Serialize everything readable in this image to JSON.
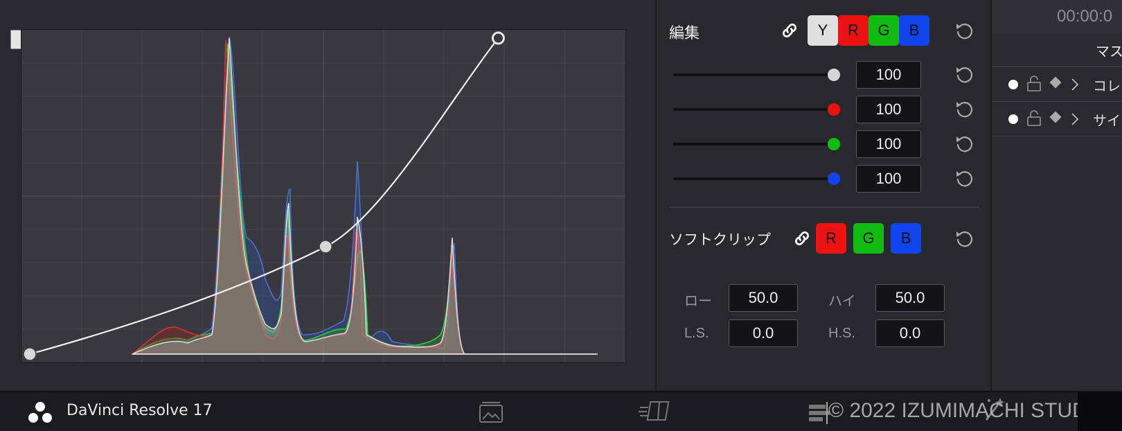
{
  "curve": {
    "point_markers": [
      {
        "x": 0.0,
        "y": 0.0
      },
      {
        "x": 0.562,
        "y": 0.34
      },
      {
        "x": 0.89,
        "y": 1.0
      }
    ]
  },
  "edit": {
    "title": "編集",
    "channels": [
      "Y",
      "R",
      "G",
      "B"
    ],
    "sliders": [
      {
        "value": "100",
        "level": 100
      },
      {
        "value": "100",
        "level": 100
      },
      {
        "value": "100",
        "level": 100
      },
      {
        "value": "100",
        "level": 100
      }
    ]
  },
  "softclip": {
    "title": "ソフトクリップ",
    "channels": [
      "R",
      "G",
      "B"
    ],
    "low_label": "ロー",
    "low_value": "50.0",
    "high_label": "ハイ",
    "high_value": "50.0",
    "ls_label": "L.S.",
    "ls_value": "0.0",
    "hs_label": "H.S.",
    "hs_value": "0.0"
  },
  "right": {
    "timecode": "00:00:0",
    "header": "マス",
    "rows": [
      "コレ",
      "サイ"
    ]
  },
  "footer": {
    "app_name": "DaVinci Resolve 17",
    "watermark": "© 2022 IZUMIMACHI STUDIO"
  },
  "colors": {
    "y": "#dddddd",
    "red": "#ee1111",
    "green": "#11bb11",
    "blue": "#1144ee",
    "panel_bg": "#26262b"
  }
}
